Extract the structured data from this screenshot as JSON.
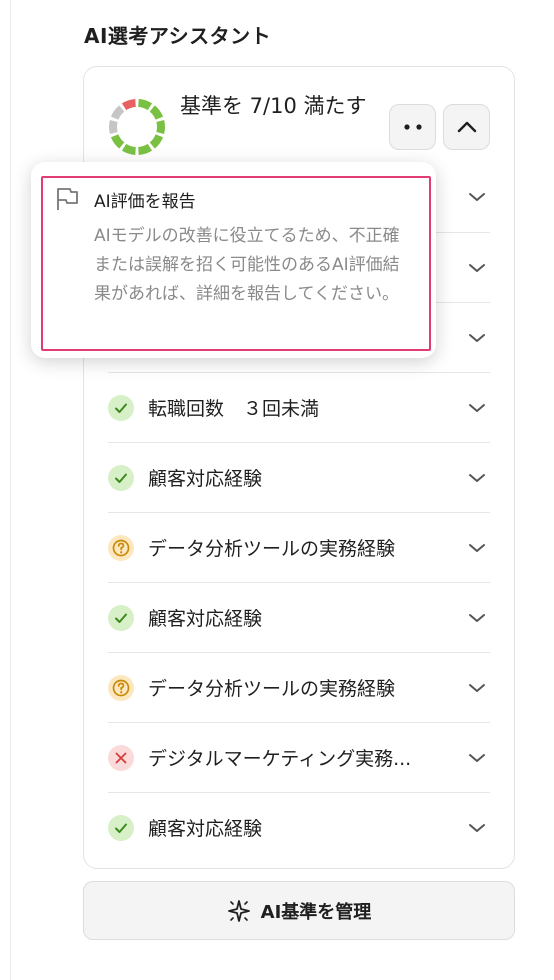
{
  "panel": {
    "title": "AI選考アシスタント"
  },
  "summary": {
    "text": "基準を 7/10 満たす",
    "met": 7,
    "total": 10,
    "segments": [
      "ok",
      "ok",
      "ok",
      "ok",
      "ok",
      "ok",
      "ok",
      "unknown",
      "unknown",
      "ng"
    ]
  },
  "colors": {
    "ok": "#7ac143",
    "unknown": "#c6c6c6",
    "ng": "#e86060",
    "warn": "#e3a21a",
    "accent": "#e23d73"
  },
  "report_popup": {
    "icon": "flag-icon",
    "title": "AI評価を報告",
    "description": "AIモデルの改善に役立てるため、不正確または誤解を招く可能性のあるAI評価結果があれば、詳細を報告してください。"
  },
  "criteria": [
    {
      "label": "転職回数　３回未満",
      "status": "ok"
    },
    {
      "label": "顧客対応経験",
      "status": "ok"
    },
    {
      "label": "データ分析ツールの実務経験",
      "status": "warn"
    },
    {
      "label": "顧客対応経験",
      "status": "ok"
    },
    {
      "label": "データ分析ツールの実務経験",
      "status": "warn"
    },
    {
      "label": "デジタルマーケティング実務...",
      "status": "ng"
    },
    {
      "label": "顧客対応経験",
      "status": "ok"
    }
  ],
  "manage_button": {
    "label": "AI基準を管理",
    "icon": "sparkle-icon"
  }
}
